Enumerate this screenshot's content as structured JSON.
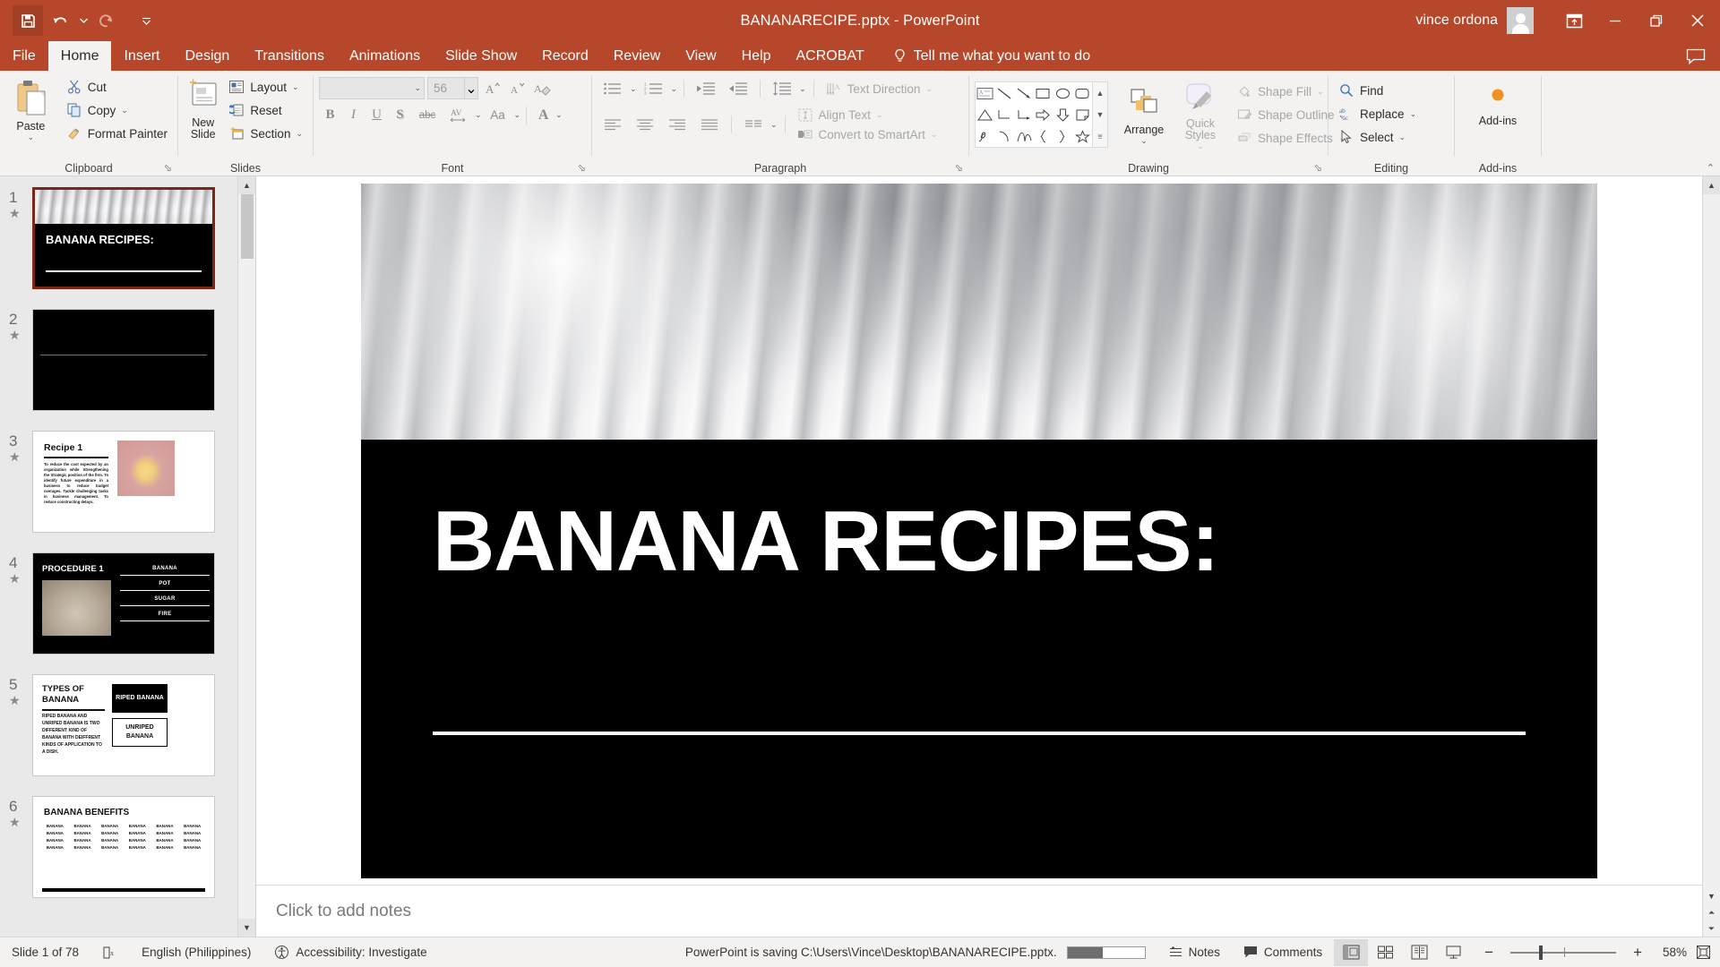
{
  "titlebar": {
    "document_title": "BANANARECIPE.pptx  -  PowerPoint",
    "account_name": "vince ordona",
    "quick_access": [
      {
        "name": "save",
        "label": "Save"
      },
      {
        "name": "undo",
        "label": "Undo"
      },
      {
        "name": "redo",
        "label": "Redo"
      },
      {
        "name": "customize",
        "label": "Customize Quick Access Toolbar"
      }
    ],
    "window_buttons": [
      {
        "name": "ribbon-display-options",
        "label": "Ribbon Display Options"
      },
      {
        "name": "minimize",
        "label": "Minimize"
      },
      {
        "name": "restore",
        "label": "Restore Down"
      },
      {
        "name": "close",
        "label": "Close"
      }
    ],
    "accent_color": "#b7472a"
  },
  "tabs": [
    {
      "label": "File",
      "active": false
    },
    {
      "label": "Home",
      "active": true
    },
    {
      "label": "Insert",
      "active": false
    },
    {
      "label": "Design",
      "active": false
    },
    {
      "label": "Transitions",
      "active": false
    },
    {
      "label": "Animations",
      "active": false
    },
    {
      "label": "Slide Show",
      "active": false
    },
    {
      "label": "Record",
      "active": false
    },
    {
      "label": "Review",
      "active": false
    },
    {
      "label": "View",
      "active": false
    },
    {
      "label": "Help",
      "active": false
    },
    {
      "label": "ACROBAT",
      "active": false
    }
  ],
  "tell_me": "Tell me what you want to do",
  "ribbon": {
    "clipboard": {
      "label": "Clipboard",
      "paste": "Paste",
      "items": [
        "Cut",
        "Copy",
        "Format Painter"
      ]
    },
    "slides": {
      "label": "Slides",
      "new_slide": "New Slide",
      "items": [
        "Layout",
        "Reset",
        "Section"
      ]
    },
    "font": {
      "label": "Font",
      "font_name": "",
      "font_size": "56",
      "buttons": [
        "Bold",
        "Italic",
        "Underline",
        "Text Shadow",
        "Strikethrough",
        "Character Spacing",
        "Change Case",
        "Font Color",
        "Increase Font Size",
        "Decrease Font Size",
        "Clear All Formatting"
      ]
    },
    "paragraph": {
      "label": "Paragraph",
      "items": [
        "Text Direction",
        "Align Text",
        "Convert to SmartArt"
      ],
      "buttons": [
        "Bullets",
        "Numbering",
        "Decrease Indent",
        "Increase Indent",
        "Line Spacing",
        "Align Left",
        "Center",
        "Align Right",
        "Justify",
        "Columns"
      ]
    },
    "drawing": {
      "label": "Drawing",
      "arrange": "Arrange",
      "quick_styles": "Quick Styles",
      "items": [
        "Shape Fill",
        "Shape Outline",
        "Shape Effects"
      ],
      "shapes": [
        "text-box",
        "line",
        "line-arrow",
        "rectangle",
        "oval",
        "rounded-rectangle",
        "triangle",
        "elbow-connector",
        "elbow-arrow-connector",
        "right-arrow",
        "down-arrow",
        "folded-corner",
        "scribble",
        "arc",
        "curve",
        "left-brace",
        "right-brace",
        "star"
      ]
    },
    "editing": {
      "label": "Editing",
      "items": [
        "Find",
        "Replace",
        "Select"
      ]
    },
    "addins": {
      "label": "Add-ins",
      "button": "Add-ins"
    }
  },
  "thumbnails": [
    {
      "number": "1",
      "selected": true,
      "type": "title",
      "title": "BANANA RECIPES:"
    },
    {
      "number": "2",
      "selected": false,
      "type": "image-only",
      "title": ""
    },
    {
      "number": "3",
      "selected": false,
      "type": "recipe",
      "title": "Recipe 1",
      "body": "To reduce the cost expected by an organization while Strengthening the Strategic position of the firm. To identify future expenditure in a business to reduce budget overages. Tackle challenging tasks in business management. To reduce constructing delays."
    },
    {
      "number": "4",
      "selected": false,
      "type": "procedure",
      "title": "PROCEDURE 1",
      "items": [
        "BANANA",
        "POT",
        "SUGAR",
        "FIRE"
      ]
    },
    {
      "number": "5",
      "selected": false,
      "type": "types",
      "title": "TYPES OF BANANA",
      "body": "RIPED BANANA AND UNRIPED BANANA IS TWO DIFFERENT KIND OF BANANA WITH DEIFFRENT KINDS OF APPLICATION TO A DISH.",
      "box1": "RIPED BANANA",
      "box2": "UNRIPED BANANA"
    },
    {
      "number": "6",
      "selected": false,
      "type": "benefits",
      "title": "BANANA BENEFITS",
      "cells": [
        "BANANA",
        "BANANA",
        "BANANA",
        "BANANA",
        "BANANA",
        "BANANA",
        "BANANA",
        "BANANA",
        "BANANA",
        "BANANA",
        "BANANA",
        "BANANA",
        "BANANA",
        "BANANA",
        "BANANA",
        "BANANA",
        "BANANA",
        "BANANA",
        "BANANA",
        "BANANA",
        "BANANA",
        "BANANA",
        "BANANA",
        "BANANA"
      ]
    }
  ],
  "slide": {
    "title": "BANANA RECIPES:"
  },
  "notes": {
    "placeholder": "Click to add notes"
  },
  "statusbar": {
    "slide_count": "Slide 1 of 78",
    "language": "English (Philippines)",
    "accessibility": "Accessibility: Investigate",
    "saving_message": "PowerPoint is saving C:\\Users\\Vince\\Desktop\\BANANARECIPE.pptx.",
    "notes_label": "Notes",
    "comments_label": "Comments",
    "zoom_level": "58%",
    "view_buttons": [
      "Normal",
      "Slide Sorter",
      "Reading View",
      "Slide Show"
    ],
    "zoom_out": "−",
    "zoom_in": "+",
    "fit_label": "Fit slide to current window"
  }
}
